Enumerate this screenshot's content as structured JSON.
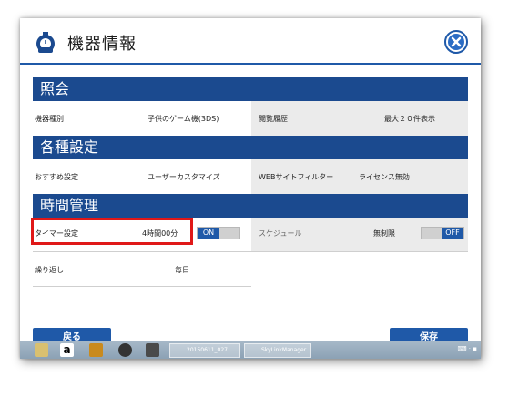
{
  "header": {
    "title": "機器情報"
  },
  "sections": {
    "inquiry": "照会",
    "settings": "各種設定",
    "time": "時間管理"
  },
  "inquiry": {
    "device_type_label": "機器種別",
    "device_type_value": "子供のゲーム機(3DS)",
    "history_label": "閲覧履歴",
    "history_value": "最大２０件表示"
  },
  "settings": {
    "recommended_label": "おすすめ設定",
    "recommended_value": "ユーザーカスタマイズ",
    "web_filter_label": "WEBサイトフィルター",
    "web_filter_value": "ライセンス無効"
  },
  "time": {
    "timer_label": "タイマー設定",
    "timer_value": "4時間00分",
    "timer_toggle": "ON",
    "schedule_label": "スケジュール",
    "schedule_value": "無制限",
    "schedule_toggle": "OFF",
    "repeat_label": "繰り返し",
    "repeat_value": "毎日"
  },
  "buttons": {
    "back": "戻る",
    "save": "保存"
  },
  "taskbar": {
    "task1": "20150611_027...",
    "task2": "SkyLinkManager",
    "tray_icons": [
      "keyboard-icon",
      "speaker-icon",
      "network-icon"
    ]
  },
  "colors": {
    "accent": "#1f59a8",
    "section": "#1b4a8f",
    "highlight": "#e01818"
  }
}
